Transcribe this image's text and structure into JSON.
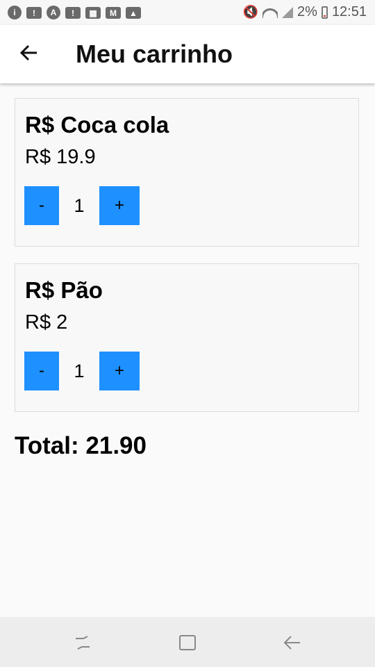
{
  "status": {
    "battery_text": "2%",
    "time": "12:51",
    "icons": [
      "badge-icon",
      "alert-icon",
      "app-a-icon",
      "alert-icon",
      "keypad-icon",
      "mail-icon",
      "image-icon"
    ]
  },
  "appbar": {
    "title": "Meu carrinho"
  },
  "cart": {
    "items": [
      {
        "name": "R$ Coca cola",
        "price": "R$ 19.9",
        "qty": "1",
        "minus": "-",
        "plus": "+"
      },
      {
        "name": "R$ Pão",
        "price": "R$ 2",
        "qty": "1",
        "minus": "-",
        "plus": "+"
      }
    ],
    "total": "Total: 21.90"
  },
  "colors": {
    "button": "#1e90ff",
    "background": "#fafafa"
  }
}
